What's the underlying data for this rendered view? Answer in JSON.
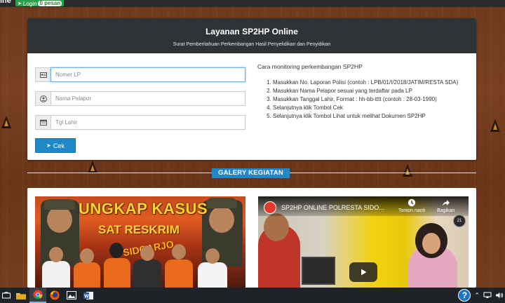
{
  "topbar": {
    "brand_fragment": "ine",
    "login_label": "Login",
    "login_badge": "0 pesan"
  },
  "panel": {
    "title": "Layanan SP2HP Online",
    "subtitle": "Surat Pemberitahuan Perkembangan Hasil Penyelidikan dan Penyidikan"
  },
  "form": {
    "nomor_placeholder": "Nomer LP",
    "nama_placeholder": "Nama Pelapor",
    "tgl_placeholder": "Tgl Lahir",
    "submit_label": "Cek"
  },
  "instructions": {
    "heading": "Cara monitoring perkembangan SP2HP",
    "steps": [
      "Masukkan No. Laporan Polisi (contoh : LPB/01/I/2018/JATIM/RESTA SDA)",
      "Masukkan Nama Pelapor sesuai yang terdaftar pada LP",
      "Masukkan Tanggal Lahir, Format : hh-bb-tttt (contoh : 28-03-1990)",
      "Selanjutnya klik Tombol Cek",
      "Selanjutnya klik Tombol Lihat untuk melihat Dokumen SP2HP"
    ]
  },
  "gallery": {
    "title": "GALERY KEGIATAN",
    "poster": {
      "line1": "UNGKAP KASUS",
      "line2": "SAT RESKRIM",
      "line3": "SIDOARJO"
    },
    "video": {
      "title": "SP2HP ONLINE POLRESTA SIDO...",
      "watch_later": "Tonton nanti",
      "share": "Bagikan",
      "logo_text": "21"
    }
  },
  "colors": {
    "accent": "#1e88c8",
    "header": "#2f3336",
    "wood": "#6e3a1d",
    "login_green": "#2e9e4a"
  }
}
